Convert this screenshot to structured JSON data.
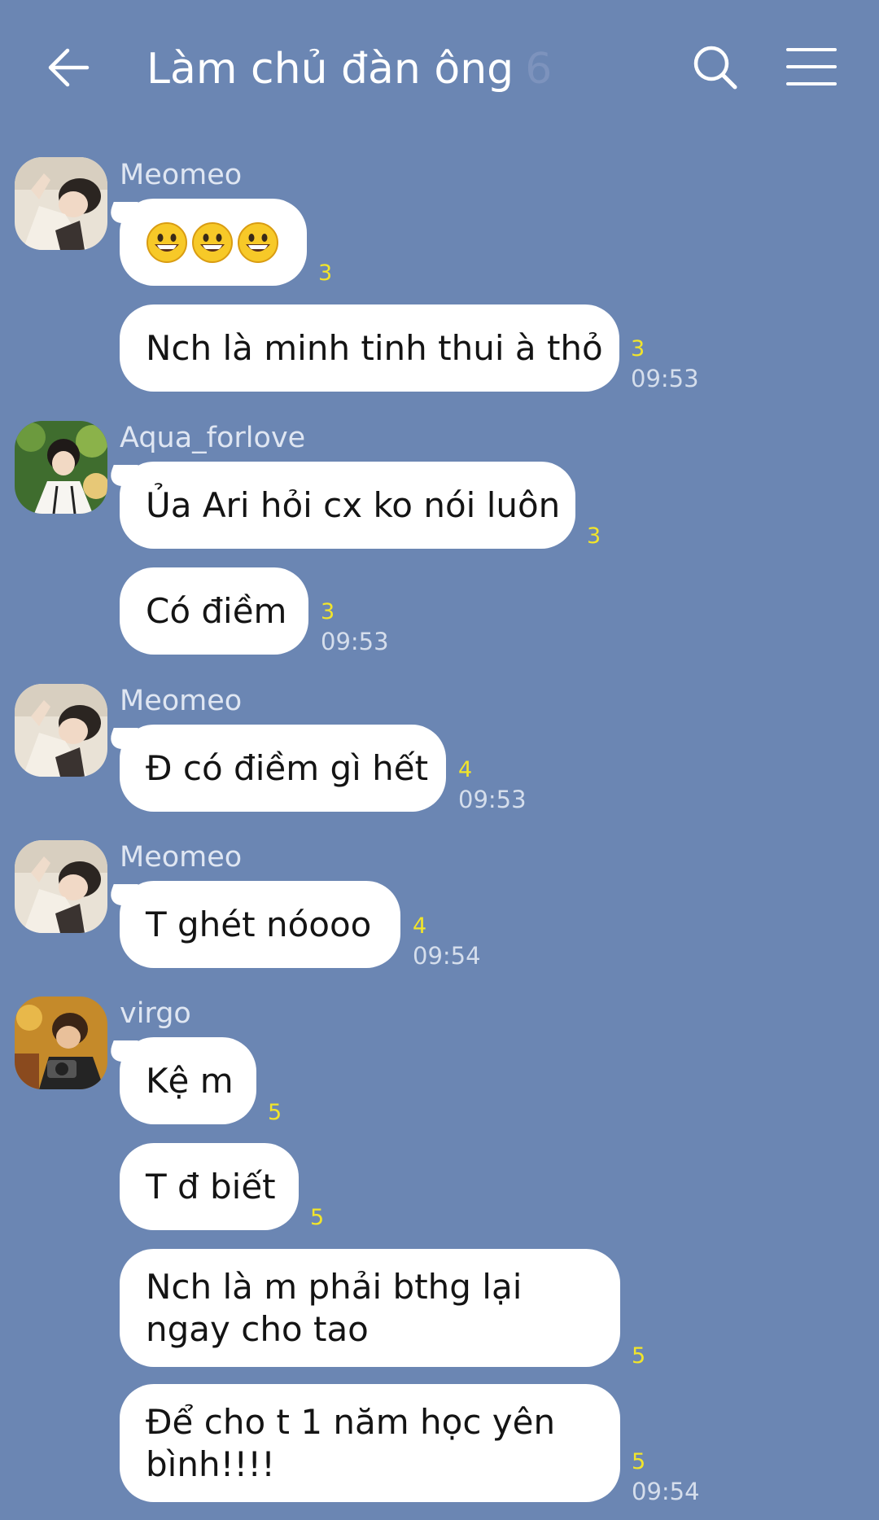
{
  "header": {
    "title": "Làm chủ đàn ông",
    "member_count": "6",
    "back_icon": "arrow-left-icon",
    "search_icon": "search-icon",
    "menu_icon": "hamburger-menu-icon"
  },
  "colors": {
    "background": "#6b86b3",
    "bubble": "#ffffff",
    "read_count": "#f2e52a",
    "sender": "#dfe6f2",
    "timestamp": "#d5deec"
  },
  "messages": [
    {
      "sender": "Meomeo",
      "text": "",
      "emoji": "grinning-face-emoji x3",
      "read": "3",
      "time": ""
    },
    {
      "sender": "",
      "text": "Nch là minh tinh thui à thỏ",
      "read": "3",
      "time": "09:53"
    },
    {
      "sender": "Aqua_forlove",
      "text": "Ủa Ari hỏi cx ko nói luôn",
      "read": "3",
      "time": ""
    },
    {
      "sender": "",
      "text": "Có điềm",
      "read": "3",
      "time": "09:53"
    },
    {
      "sender": "Meomeo",
      "text": "Đ có điềm gì hết",
      "read": "4",
      "time": "09:53"
    },
    {
      "sender": "Meomeo",
      "text": "T ghét nóooo",
      "read": "4",
      "time": "09:54"
    },
    {
      "sender": "virgo",
      "text": "Kệ m",
      "read": "5",
      "time": ""
    },
    {
      "sender": "",
      "text": "T đ biết",
      "read": "5",
      "time": ""
    },
    {
      "sender": "",
      "text": "Nch là m phải bthg lại ngay cho tao",
      "read": "5",
      "time": ""
    },
    {
      "sender": "",
      "text": "Để cho t 1 năm học yên bình!!!!",
      "read": "5",
      "time": "09:54"
    }
  ]
}
